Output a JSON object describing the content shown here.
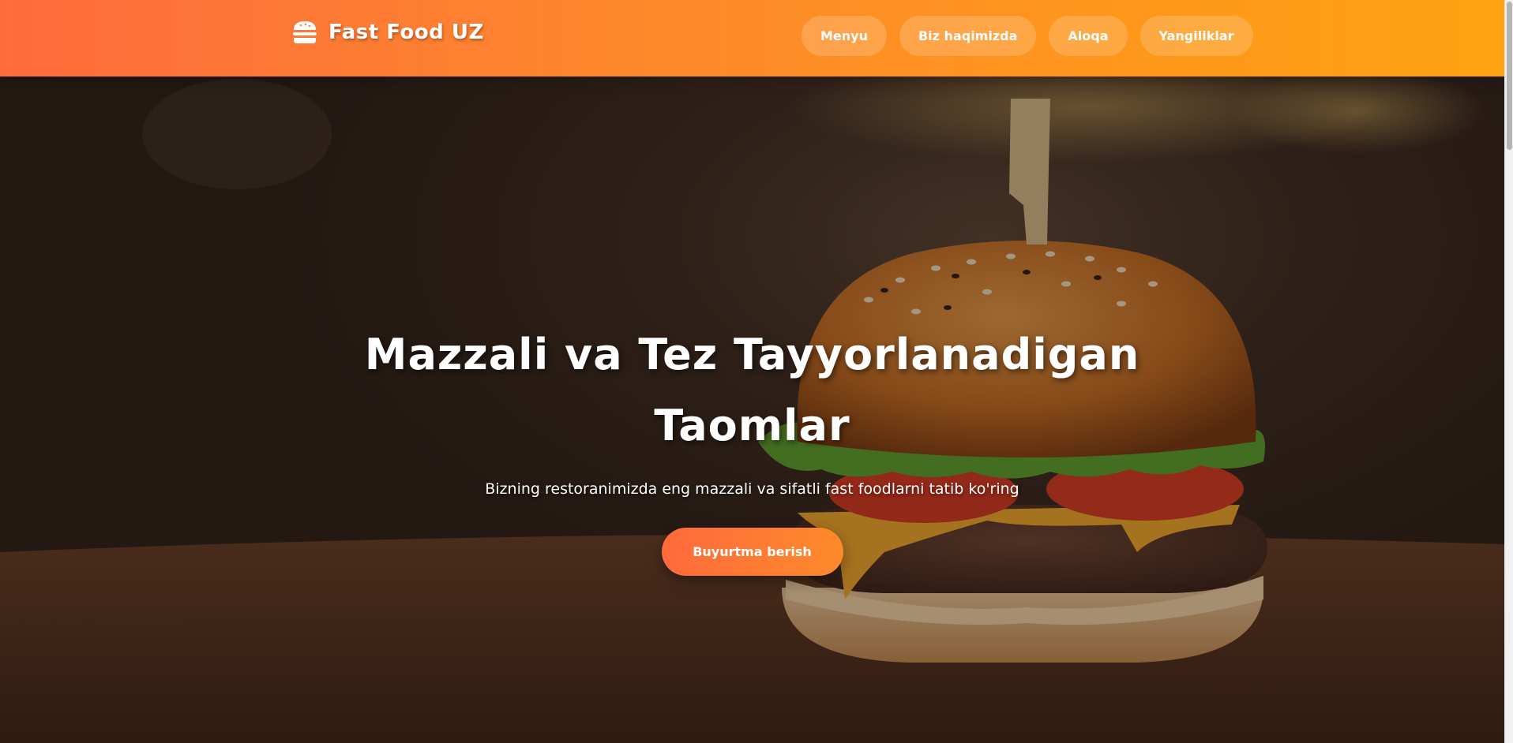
{
  "brand": {
    "icon": "burger-icon",
    "name": "Fast Food UZ"
  },
  "nav": {
    "items": [
      {
        "label": "Menyu"
      },
      {
        "label": "Biz haqimizda"
      },
      {
        "label": "Aloqa"
      },
      {
        "label": "Yangiliklar"
      }
    ]
  },
  "hero": {
    "background": "burger-photo",
    "title": "Mazzali va Tez Tayyorlanadigan Taomlar",
    "subtitle": "Bizning restoranimizda eng mazzali va sifatli fast foodlarni tatib ko'ring",
    "cta_label": "Buyurtma berish"
  },
  "colors": {
    "header_start": "#ff6b3d",
    "header_end": "#ffa210",
    "accent": "#fd8a2a"
  }
}
